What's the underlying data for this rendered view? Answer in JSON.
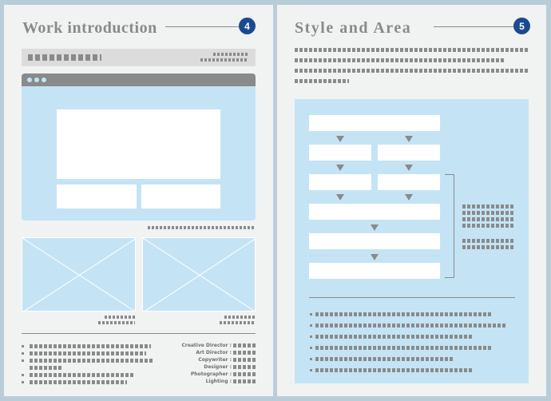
{
  "left_page": {
    "title": "Work introduction",
    "number": "4",
    "credits": [
      "Creative Director :",
      "Art Director :",
      "Copywriter :",
      "Designer :",
      "Photographer :",
      "Lighting :"
    ]
  },
  "right_page": {
    "title": "Style and Area",
    "number": "5"
  },
  "colors": {
    "background": "#b9cdd8",
    "page": "#f1f2f2",
    "accent_blue": "#1b4a8f",
    "light_blue": "#c4e4f5",
    "gray": "#8a8a8a"
  }
}
